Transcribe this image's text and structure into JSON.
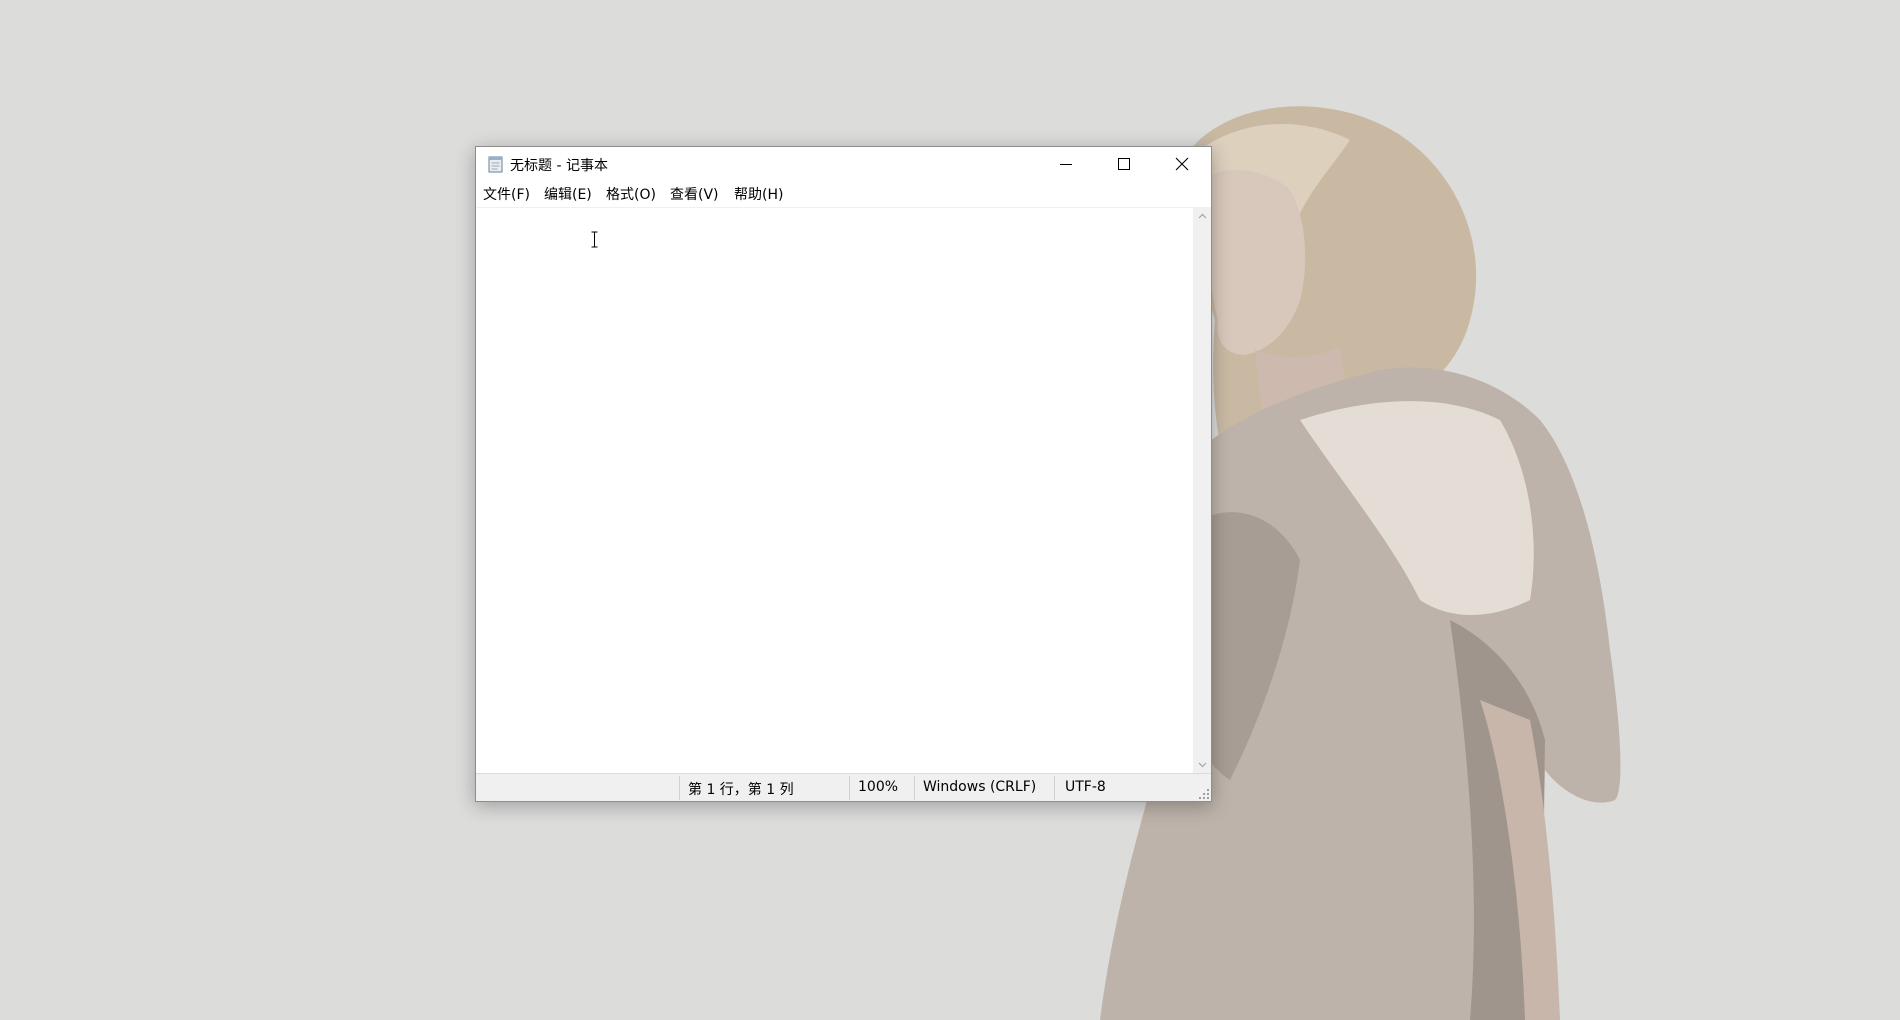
{
  "window": {
    "title": "无标题 - 记事本",
    "app_icon": "notepad-icon",
    "controls": {
      "minimize_icon": "minimize-icon",
      "maximize_icon": "maximize-icon",
      "close_icon": "close-icon"
    }
  },
  "menu": {
    "items": [
      {
        "label": "文件(F)"
      },
      {
        "label": "编辑(E)"
      },
      {
        "label": "格式(O)"
      },
      {
        "label": "查看(V)"
      },
      {
        "label": "帮助(H)"
      }
    ]
  },
  "editor": {
    "content": ""
  },
  "statusbar": {
    "position": "第 1 行，第 1 列",
    "zoom": "100%",
    "line_ending": "Windows (CRLF)",
    "encoding": "UTF-8"
  },
  "colors": {
    "desktop_bg": "#dcdcdb",
    "window_bg": "#ffffff",
    "statusbar_bg": "#f0f0f0"
  }
}
